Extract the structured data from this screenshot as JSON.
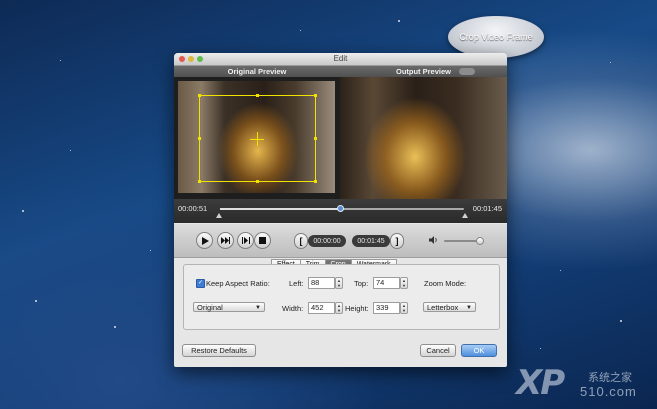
{
  "callout": {
    "text": "Crop Video Frame"
  },
  "window": {
    "title": "Edit"
  },
  "preview": {
    "original_label": "Original Preview",
    "output_label": "Output Preview"
  },
  "timeline": {
    "current_time": "00:00:51",
    "total_time": "00:01:45",
    "playhead_fraction": 0.49
  },
  "controls": {
    "icons": [
      "play-icon",
      "step-forward-icon",
      "frame-step-icon",
      "stop-icon",
      "set-start-bracket-icon",
      "set-end-bracket-icon",
      "volume-icon"
    ],
    "start_time": "00:00:00",
    "end_time": "00:01:45",
    "volume_fraction": 0.9
  },
  "tabs": [
    {
      "label": "Effect",
      "active": false
    },
    {
      "label": "Trim",
      "active": false
    },
    {
      "label": "Crop",
      "active": true
    },
    {
      "label": "Watermark",
      "active": false
    }
  ],
  "crop": {
    "keep_aspect_label": "Keep Aspect Ratio:",
    "keep_aspect_checked": true,
    "aspect_select": "Original",
    "left_label": "Left:",
    "left_value": "88",
    "top_label": "Top:",
    "top_value": "74",
    "width_label": "Width:",
    "width_value": "452",
    "height_label": "Height:",
    "height_value": "339",
    "zoom_mode_label": "Zoom Mode:",
    "zoom_mode_value": "Letterbox"
  },
  "footer": {
    "restore_label": "Restore Defaults",
    "cancel_label": "Cancel",
    "ok_label": "OK"
  },
  "watermark": {
    "logo_text": "XP",
    "cn_text": "系统之家",
    "site_text": "510.com"
  },
  "colors": {
    "crop_frame": "#f2e200",
    "primary_button": "#4f8fdd",
    "playhead": "#5b8fd4"
  }
}
